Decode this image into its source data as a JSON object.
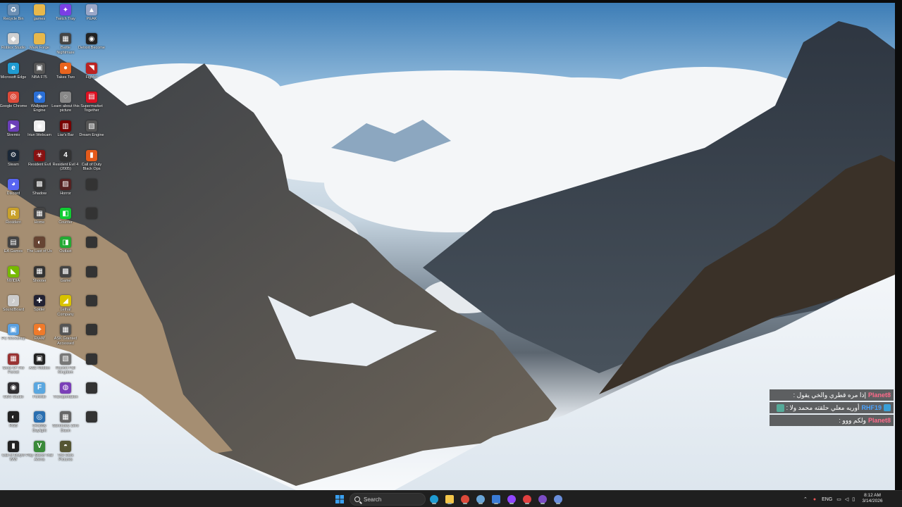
{
  "desktop": {
    "icons": [
      {
        "label": "Recycle Bin",
        "icon": "recycle-bin-icon",
        "color": "#6c8fb3",
        "glyph": "♻"
      },
      {
        "label": "games",
        "icon": "folder-icon",
        "color": "#e8b84a",
        "glyph": ""
      },
      {
        "label": "Twitch Tray",
        "icon": "twitch-icon",
        "color": "#7b3fe4",
        "glyph": "✦"
      },
      {
        "label": "PEAK",
        "icon": "peak-icon",
        "color": "#9aa7c8",
        "glyph": "▲"
      },
      {
        "label": "Roblox Studio",
        "icon": "roblox-icon",
        "color": "#d0d0d0",
        "glyph": "◆"
      },
      {
        "label": "Mark Forge",
        "icon": "folder-icon",
        "color": "#e8b84a",
        "glyph": ""
      },
      {
        "label": "Battle Nightmare",
        "icon": "game-icon",
        "color": "#444",
        "glyph": "▦"
      },
      {
        "label": "Detroit Become",
        "icon": "game-icon",
        "color": "#222",
        "glyph": "◉"
      },
      {
        "label": "Microsoft Edge",
        "icon": "edge-icon",
        "color": "#1f9bd1",
        "glyph": "e"
      },
      {
        "label": "NBA F75",
        "icon": "game-icon",
        "color": "#555",
        "glyph": "▣"
      },
      {
        "label": "Takes Two",
        "icon": "game-icon",
        "color": "#e8641e",
        "glyph": "●"
      },
      {
        "label": "Fighter",
        "icon": "game-icon",
        "color": "#b22",
        "glyph": "◥"
      },
      {
        "label": "Google Chrome",
        "icon": "chrome-icon",
        "color": "#dd4a3a",
        "glyph": "◎"
      },
      {
        "label": "Wallpaper Engine",
        "icon": "wallpaper-engine-icon",
        "color": "#2a6fd6",
        "glyph": "◈"
      },
      {
        "label": "Learn about this picture",
        "icon": "info-icon",
        "color": "#888",
        "glyph": "◌"
      },
      {
        "label": "Supermarket Together",
        "icon": "game-icon",
        "color": "#d12",
        "glyph": "▤"
      },
      {
        "label": "Stremio",
        "icon": "stremio-icon",
        "color": "#6b3fb8",
        "glyph": "▶"
      },
      {
        "label": "Iriun Webcam",
        "icon": "webcam-icon",
        "color": "#eee",
        "glyph": "◉"
      },
      {
        "label": "Liar's Bar",
        "icon": "game-icon",
        "color": "#700",
        "glyph": "▥"
      },
      {
        "label": "Dream Engine",
        "icon": "game-icon",
        "color": "#555",
        "glyph": "▧"
      },
      {
        "label": "Steam",
        "icon": "steam-icon",
        "color": "#1b2838",
        "glyph": "⚙"
      },
      {
        "label": "Resident Evil",
        "icon": "game-icon",
        "color": "#811",
        "glyph": "☣"
      },
      {
        "label": "Resident Evil 4 (2005)",
        "icon": "game-icon",
        "color": "#333",
        "glyph": "4"
      },
      {
        "label": "Call of Duty Black Ops",
        "icon": "game-icon",
        "color": "#e35a1b",
        "glyph": "▮"
      },
      {
        "label": "Discord",
        "icon": "discord-icon",
        "color": "#5865f2",
        "glyph": "◕"
      },
      {
        "label": "Shadow",
        "icon": "game-icon",
        "color": "#333",
        "glyph": "▩"
      },
      {
        "label": "Horror",
        "icon": "game-icon",
        "color": "#522",
        "glyph": "▨"
      },
      {
        "label": "",
        "icon": "game-icon",
        "color": "#333",
        "glyph": ""
      },
      {
        "label": "Resident",
        "icon": "game-icon",
        "color": "#c9a12b",
        "glyph": "R"
      },
      {
        "label": "Home",
        "icon": "game-icon",
        "color": "#444",
        "glyph": "▦"
      },
      {
        "label": "Counter",
        "icon": "game-icon",
        "color": "#1c3",
        "glyph": "◧"
      },
      {
        "label": "",
        "icon": "game-icon",
        "color": "#333",
        "glyph": ""
      },
      {
        "label": "EA Games",
        "icon": "game-icon",
        "color": "#444",
        "glyph": "▤"
      },
      {
        "label": "The Last of Us",
        "icon": "game-icon",
        "color": "#643",
        "glyph": "◐"
      },
      {
        "label": "Outlast",
        "icon": "game-icon",
        "color": "#2a3",
        "glyph": "◨"
      },
      {
        "label": "",
        "icon": "game-icon",
        "color": "#333",
        "glyph": ""
      },
      {
        "label": "NVIDIA",
        "icon": "nvidia-icon",
        "color": "#76b900",
        "glyph": "◣"
      },
      {
        "label": "Shooter",
        "icon": "game-icon",
        "color": "#333",
        "glyph": "▦"
      },
      {
        "label": "Game",
        "icon": "game-icon",
        "color": "#444",
        "glyph": "▩"
      },
      {
        "label": "",
        "icon": "game-icon",
        "color": "#333",
        "glyph": ""
      },
      {
        "label": "SoundBoard",
        "icon": "sound-icon",
        "color": "#ccc",
        "glyph": "♪"
      },
      {
        "label": "Spider",
        "icon": "game-icon",
        "color": "#223",
        "glyph": "✚"
      },
      {
        "label": "Lethal Company",
        "icon": "game-icon",
        "color": "#d8c200",
        "glyph": "◢"
      },
      {
        "label": "",
        "icon": "game-icon",
        "color": "#333",
        "glyph": ""
      },
      {
        "label": "PC Workshop",
        "icon": "pc-icon",
        "color": "#5aa0e0",
        "glyph": "▣"
      },
      {
        "label": "FiveM",
        "icon": "fivem-icon",
        "color": "#f07a2a",
        "glyph": "✦"
      },
      {
        "label": "ASK Granted Accessed",
        "icon": "game-icon",
        "color": "#555",
        "glyph": "▦"
      },
      {
        "label": "",
        "icon": "game-icon",
        "color": "#333",
        "glyph": ""
      },
      {
        "label": "Sons Of The Forest",
        "icon": "game-icon",
        "color": "#933",
        "glyph": "▦"
      },
      {
        "label": "ASE Roblox",
        "icon": "game-icon",
        "color": "#222",
        "glyph": "▣"
      },
      {
        "label": "Rocket Fall Kingdom",
        "icon": "game-icon",
        "color": "#777",
        "glyph": "▧"
      },
      {
        "label": "",
        "icon": "game-icon",
        "color": "#333",
        "glyph": ""
      },
      {
        "label": "OBS Studio",
        "icon": "obs-icon",
        "color": "#302e31",
        "glyph": "◉"
      },
      {
        "label": "Fortnite",
        "icon": "fortnite-icon",
        "color": "#5aa7e0",
        "glyph": "F"
      },
      {
        "label": "Transportation",
        "icon": "game-icon",
        "color": "#7a3fb8",
        "glyph": "◍"
      },
      {
        "label": "",
        "icon": "game-icon",
        "color": "#333",
        "glyph": ""
      },
      {
        "label": "RGB",
        "icon": "rgb-icon",
        "color": "#222",
        "glyph": "◐"
      },
      {
        "label": "DeadBy Daylight",
        "icon": "game-icon",
        "color": "#2a6fb0",
        "glyph": "◎"
      },
      {
        "label": "Sanctuary Zero Dawn",
        "icon": "game-icon",
        "color": "#666",
        "glyph": "▦"
      },
      {
        "label": "",
        "icon": "game-icon",
        "color": "#333",
        "glyph": ""
      },
      {
        "label": "Call of Duty® WW",
        "icon": "game-icon",
        "color": "#222",
        "glyph": "▮"
      },
      {
        "label": "Play Stand Trail Arena",
        "icon": "game-icon",
        "color": "#3a8a3a",
        "glyph": "V"
      },
      {
        "label": "The Dark Pictures",
        "icon": "game-icon",
        "color": "#553",
        "glyph": "◓"
      }
    ]
  },
  "chat": {
    "messages": [
      {
        "user": "Planet8",
        "text": "إذا مره قطري والخي يقول :",
        "user_color": "#ff6b8b",
        "has_avatar": false
      },
      {
        "user": "RHF19",
        "text": "أوريه معلي حلقته محمد ولا :",
        "user_color": "#4aa3ff",
        "has_avatar": true
      },
      {
        "user": "Planet8",
        "text": "ولكم ووو :",
        "user_color": "#ff6b8b",
        "has_avatar": false
      }
    ]
  },
  "taskbar": {
    "search_placeholder": "Search",
    "pinned": [
      {
        "name": "start-button",
        "icon": "windows-start-icon",
        "color": "#3aa0f0"
      },
      {
        "name": "edge-button",
        "icon": "edge-icon",
        "color": "#1f9bd1"
      },
      {
        "name": "files-button",
        "icon": "file-explorer-icon",
        "color": "#f3c64a"
      },
      {
        "name": "chrome-button",
        "icon": "chrome-icon",
        "color": "#dd4a3a"
      },
      {
        "name": "steam-button",
        "icon": "steam-icon",
        "color": "#6aa6d8"
      },
      {
        "name": "store-button",
        "icon": "store-icon",
        "color": "#3a7bd5"
      },
      {
        "name": "twitch-button",
        "icon": "twitch-icon",
        "color": "#9146ff"
      },
      {
        "name": "capture-button",
        "icon": "capture-icon",
        "color": "#e04040"
      },
      {
        "name": "stremio-button",
        "icon": "stremio-icon",
        "color": "#7b4cc4"
      },
      {
        "name": "browser-button",
        "icon": "globe-icon",
        "color": "#6a8fdc"
      }
    ],
    "tray": {
      "language": "ENG",
      "time": "8:12 AM",
      "date": "3/14/2026"
    }
  }
}
